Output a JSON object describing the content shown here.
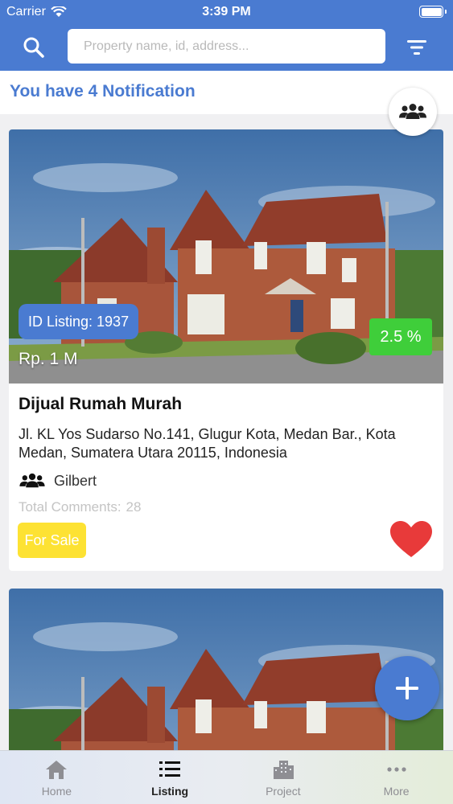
{
  "status_bar": {
    "carrier": "Carrier",
    "time": "3:39 PM"
  },
  "search": {
    "placeholder": "Property name, id, address..."
  },
  "notification": {
    "text": "You have 4 Notification"
  },
  "listings": [
    {
      "id_label": "ID Listing: 1937",
      "commission": "2.5 %",
      "price": "Rp. 1 M",
      "title": "Dijual Rumah Murah",
      "address": "Jl. KL Yos Sudarso No.141, Glugur Kota, Medan Bar., Kota Medan, Sumatera Utara 20115, Indonesia",
      "agent": "Gilbert",
      "comments_label": "Total Comments:",
      "comments_count": "28",
      "status": "For Sale",
      "favorite": true
    }
  ],
  "tabs": [
    {
      "label": "Home",
      "icon": "home-icon",
      "active": false
    },
    {
      "label": "Listing",
      "icon": "list-icon",
      "active": true
    },
    {
      "label": "Project",
      "icon": "building-icon",
      "active": false
    },
    {
      "label": "More",
      "icon": "more-icon",
      "active": false
    }
  ],
  "colors": {
    "primary": "#4a7bd1",
    "commission_badge": "#3fce3a",
    "sale_badge": "#fde233",
    "favorite": "#e83a3a"
  }
}
